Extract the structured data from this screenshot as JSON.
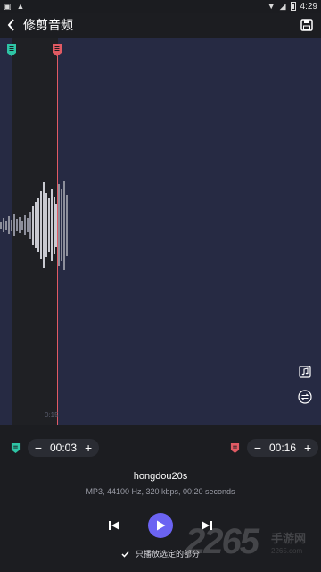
{
  "status_bar": {
    "time": "4:29",
    "icons": [
      "screenshot-icon",
      "download-icon",
      "wifi-icon",
      "signal-icon",
      "battery-icon"
    ]
  },
  "header": {
    "title": "修剪音频",
    "back_icon": "chevron-left-icon",
    "save_icon": "save-icon"
  },
  "waveform": {
    "time_tick": "0:15",
    "start_marker_color": "#2ec4a5",
    "end_marker_color": "#e05a63",
    "tools": [
      "music-note-icon",
      "swap-icon"
    ]
  },
  "trim": {
    "start": {
      "minus": "−",
      "value": "00:03",
      "plus": "+"
    },
    "end": {
      "minus": "−",
      "value": "00:16",
      "plus": "+"
    }
  },
  "file": {
    "name": "hongdou20s",
    "info": "MP3, 44100 Hz, 320 kbps, 00:20 seconds"
  },
  "transport": {
    "prev_icon": "skip-previous-icon",
    "play_icon": "play-icon",
    "next_icon": "skip-next-icon",
    "accent": "#6b63f2"
  },
  "options": {
    "play_selected_label": "只播放选定的部分",
    "play_selected_checked": true
  },
  "watermark": {
    "big": "2265",
    "small": "手游网",
    "url": "2265.com"
  }
}
